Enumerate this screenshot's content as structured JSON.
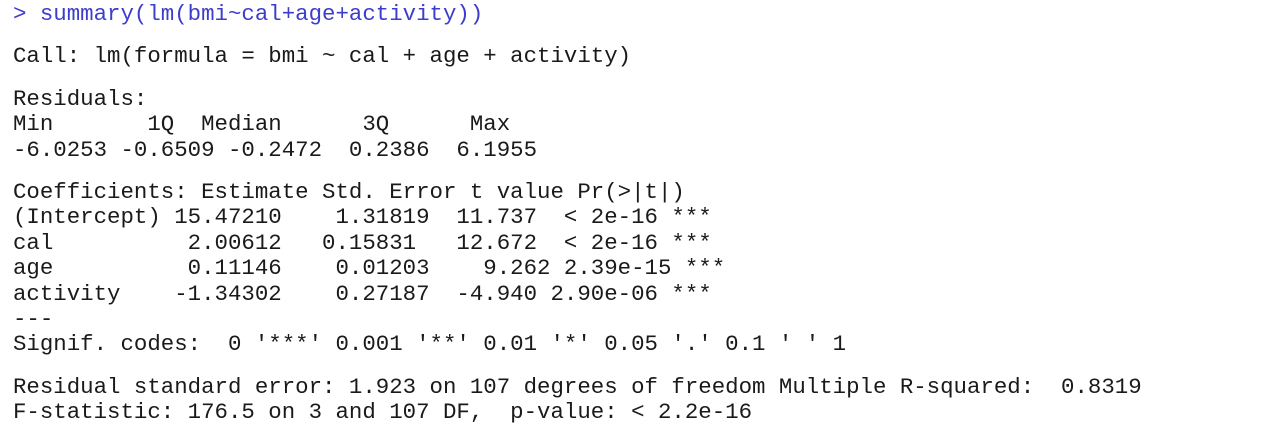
{
  "console": {
    "prompt_symbol": ">",
    "command": "summary(lm(bmi~cal+age+activity))",
    "call": "Call: lm(formula = bmi ~ cal + age + activity)",
    "residuals": {
      "heading": "Residuals:",
      "labels_row": "Min       1Q  Median      3Q      Max",
      "values_row": "-6.0253 -0.6509 -0.2472  0.2386  6.1955"
    },
    "coefficients": {
      "header_row": "Coefficients: Estimate Std. Error t value Pr(>|t|)",
      "rows": [
        "(Intercept) 15.47210    1.31819  11.737  < 2e-16 ***",
        "cal          2.00612   0.15831   12.672  < 2e-16 ***",
        "age          0.11146    0.01203    9.262 2.39e-15 ***",
        "activity    -1.34302    0.27187  -4.940 2.90e-06 ***"
      ],
      "separator": "---",
      "signif_codes": "Signif. codes:  0 '***' 0.001 '**' 0.01 '*' 0.05 '.' 0.1 ' ' 1"
    },
    "fit": {
      "residual_line": "Residual standard error: 1.923 on 107 degrees of freedom Multiple R-squared:  0.8319",
      "fstat_line": "F-statistic: 176.5 on 3 and 107 DF,  p-value: < 2.2e-16"
    },
    "colors": {
      "prompt": "#3d3dcc",
      "output": "#1a1a1a",
      "background": "#ffffff"
    }
  }
}
